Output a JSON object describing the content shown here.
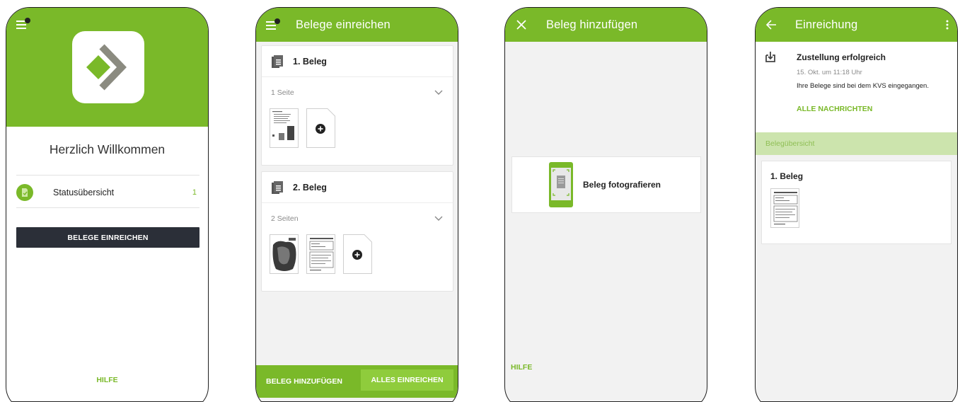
{
  "colors": {
    "accent": "#7ab929",
    "accent_light": "#8fcc3c",
    "dark_button": "#2b2f38",
    "section_bg": "#cce4ad"
  },
  "screen1": {
    "welcome": "Herzlich Willkommen",
    "status_label": "Statusübersicht",
    "status_count": "1",
    "submit_button": "BELEGE EINREICHEN",
    "help": "HILFE",
    "icons": [
      "menu-icon",
      "app-logo",
      "document-check-icon"
    ]
  },
  "screen2": {
    "title": "Belege einreichen",
    "belege": [
      {
        "label": "1. Beleg",
        "pages": "1 Seite"
      },
      {
        "label": "2. Beleg",
        "pages": "2 Seiten"
      }
    ],
    "add_button": "BELEG HINZUFÜGEN",
    "submit_all_button": "ALLES EINREICHEN",
    "icons": [
      "menu-icon",
      "document-icon",
      "chevron-down-icon",
      "add-page-icon"
    ]
  },
  "screen3": {
    "title": "Beleg hinzufügen",
    "photo_label": "Beleg fotografieren",
    "help": "HILFE",
    "icons": [
      "close-icon",
      "phone-camera-icon"
    ]
  },
  "screen4": {
    "title": "Einreichung",
    "notice_title": "Zustellung erfolgreich",
    "notice_date": "15. Okt. um 11:18 Uhr",
    "notice_text": "Ihre Belege sind bei dem KVS eingegangen.",
    "notice_link": "ALLE NACHRICHTEN",
    "section": "Belegübersicht",
    "beleg_label": "1. Beleg",
    "icons": [
      "back-arrow-icon",
      "more-vert-icon",
      "download-icon"
    ]
  }
}
